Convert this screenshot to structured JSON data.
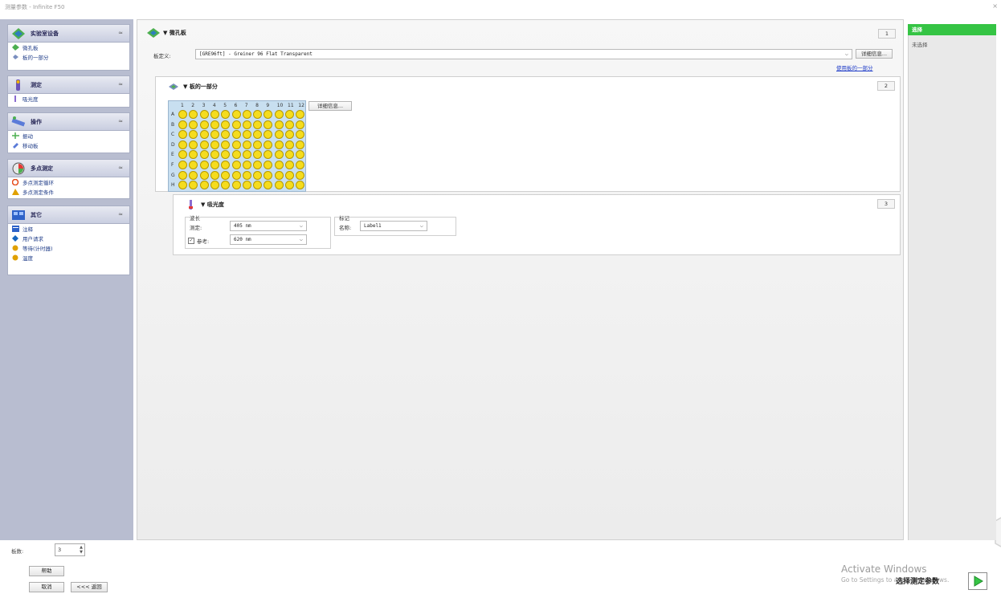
{
  "window": {
    "title": "测量参数 - Infinite F50",
    "close": "×"
  },
  "sidebar": {
    "groups": [
      {
        "title": "实验室设备",
        "items": [
          "微孔板",
          "板的一部分"
        ]
      },
      {
        "title": "测定",
        "items": [
          "吸光度"
        ]
      },
      {
        "title": "操作",
        "items": [
          "振动",
          "移动板"
        ]
      },
      {
        "title": "多点测定",
        "items": [
          "多点测定循环",
          "多点测定条件"
        ]
      },
      {
        "title": "其它",
        "items": [
          "注释",
          "用户请求",
          "等待(计时器)",
          "温度"
        ]
      }
    ],
    "collapse_glyph": "≈"
  },
  "footer": {
    "plates_label": "板数:",
    "plates_value": "3",
    "help_label": "帮助",
    "cancel_label": "取消",
    "back_label": "<<< 返回"
  },
  "microplate_section": {
    "title": "▼ 微孔板",
    "step": "1",
    "def_label": "板定义:",
    "def_value": "[GRE96ft] - Greiner 96 Flat Transparent",
    "details_btn": "详细信息...",
    "use_part_link": "使用板的一部分"
  },
  "part_section": {
    "title": "▼ 板的一部分",
    "step": "2",
    "details_btn": "详细信息...",
    "columns": [
      "1",
      "2",
      "3",
      "4",
      "5",
      "6",
      "7",
      "8",
      "9",
      "10",
      "11",
      "12"
    ],
    "rows": [
      "A",
      "B",
      "C",
      "D",
      "E",
      "F",
      "G",
      "H"
    ]
  },
  "absorbance_section": {
    "title": "▼ 吸光度",
    "step": "3",
    "wavelength_group": "波长",
    "measure_label": "测定:",
    "measure_value": "405 nm",
    "reference_label": "参考:",
    "reference_value": "620 nm",
    "reference_checked": true,
    "label_group": "标记",
    "name_label": "名称:",
    "name_value": "Label1"
  },
  "right_panel": {
    "selected": "选择",
    "unselected": "未选择"
  },
  "overlay": {
    "activate_title": "Activate Windows",
    "activate_sub": "Go to Settings to activate Windows.",
    "next_label": "选择测定参数"
  }
}
